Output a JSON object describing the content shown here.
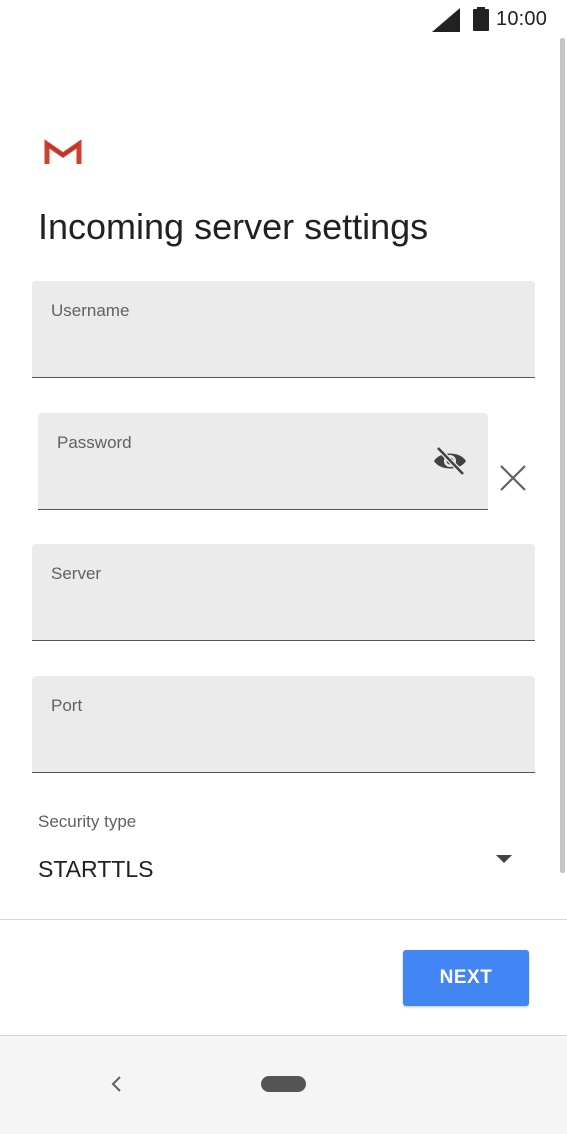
{
  "status_bar": {
    "time": "10:00",
    "icons": [
      "signal-icon",
      "battery-icon"
    ]
  },
  "app": {
    "logo_icon": "gmail-icon",
    "brand_colors": {
      "gmail_red": "#d23f31",
      "gmail_dark_red": "#a52714"
    }
  },
  "page": {
    "title": "Incoming server settings"
  },
  "form": {
    "username": {
      "label": "Username",
      "value": ""
    },
    "password": {
      "label": "Password",
      "value": "",
      "visibility_icon": "eye-off-icon",
      "clear_icon": "close-icon"
    },
    "server": {
      "label": "Server",
      "value": ""
    },
    "port": {
      "label": "Port",
      "value": ""
    },
    "security_type": {
      "label": "Security type",
      "value": "STARTTLS",
      "icon": "dropdown-arrow-icon"
    }
  },
  "actions": {
    "next_label": "NEXT",
    "next_color": "#4285f4"
  },
  "nav_bar": {
    "icons": [
      "back-icon",
      "home-icon"
    ]
  }
}
